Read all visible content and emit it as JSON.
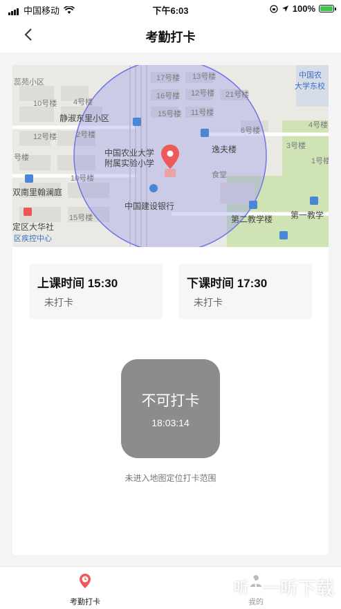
{
  "status_bar": {
    "carrier": "中国移动",
    "time": "下午6:03",
    "battery": "100%"
  },
  "nav": {
    "title": "考勤打卡",
    "back_icon": "chevron-left-icon"
  },
  "map": {
    "labels": {
      "l1": "蕊苑小区",
      "l2": "10号楼",
      "l3": "4号楼",
      "l4": "静淑东里小区",
      "l5": "12号楼",
      "l6": "2号楼",
      "l7": "号楼",
      "l8": "10号楼",
      "l9": "双南里翰澜庭",
      "l10": "定区大华社",
      "l11": "区疾控中心",
      "l12": "15号楼",
      "l13": "17号楼",
      "l14": "13号楼",
      "l15": "16号楼",
      "l16": "12号楼",
      "l17": "21号楼",
      "l18": "15号楼",
      "l19": "11号楼",
      "l20": "6号楼",
      "l21": "逸夫楼",
      "l22": "食堂",
      "l23": "中国农业大学",
      "l24": "附属实验小学",
      "l25": "中国建设银行",
      "l26": "第二教学楼",
      "l27": "第一教学",
      "l28": "中国农",
      "l29": "大学东校",
      "l30": "4号楼",
      "l31": "3号楼",
      "l32": "1号楼"
    },
    "colors": {
      "radius_fill": "#7b7ff0",
      "pin": "#ee5a5a",
      "green_area": "#cfe3b4"
    }
  },
  "class_start": {
    "title": "上课时间 15:30",
    "status": "未打卡"
  },
  "class_end": {
    "title": "下课时间 17:30",
    "status": "未打卡"
  },
  "punch": {
    "label": "不可打卡",
    "time": "18:03:14",
    "hint": "未进入地图定位打卡范围"
  },
  "tabbar": {
    "active": "考勤打卡",
    "second": "我的",
    "active_color": "#ee5a5a"
  },
  "watermark": "一听下载"
}
